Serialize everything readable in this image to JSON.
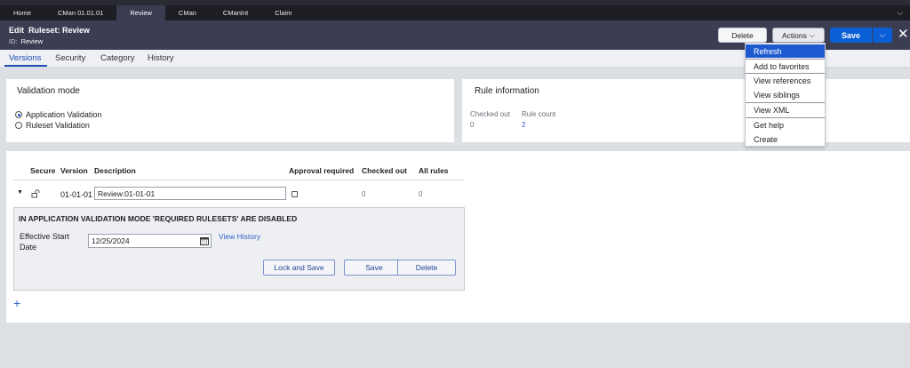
{
  "tabs": [
    {
      "label": "Home",
      "active": false
    },
    {
      "label": "CMan 01.01.01",
      "active": false
    },
    {
      "label": "Review",
      "active": true
    },
    {
      "label": "CMan",
      "active": false
    },
    {
      "label": "CManInt",
      "active": false
    },
    {
      "label": "Claim",
      "active": false
    }
  ],
  "header": {
    "edit_label": "Edit",
    "title": "Ruleset: Review",
    "id_label": "ID:",
    "id_value": "Review"
  },
  "toolbar": {
    "delete_label": "Delete",
    "actions_label": "Actions",
    "save_label": "Save"
  },
  "actions_menu": [
    {
      "label": "Refresh",
      "highlighted": true
    },
    {
      "label": "Add to favorites"
    },
    {
      "label": "View references"
    },
    {
      "label": "View siblings"
    },
    {
      "label": "View XML"
    },
    {
      "label": "Get help"
    },
    {
      "label": "Create"
    }
  ],
  "subtabs": [
    "Versions",
    "Security",
    "Category",
    "History"
  ],
  "validation": {
    "title": "Validation mode",
    "options": [
      "Application Validation",
      "Ruleset Validation"
    ],
    "selected": "Application Validation"
  },
  "rule_info": {
    "title": "Rule information",
    "checked_out_label": "Checked out",
    "checked_out_value": "0",
    "rule_count_label": "Rule count",
    "rule_count_value": "2"
  },
  "versions_table": {
    "headers": [
      "Secure",
      "Version",
      "Description",
      "Approval required",
      "Checked out",
      "All rules"
    ],
    "row": {
      "version": "01-01-01",
      "description": "Review:01-01-01",
      "checked_out": "0",
      "all_rules": "0"
    }
  },
  "detail": {
    "notice": "IN APPLICATION VALIDATION MODE 'REQUIRED RULESETS' ARE DISABLED",
    "effective_start_label": "Effective Start",
    "effective_start_label_2": "Date",
    "effective_start_value": "12/25/2024",
    "view_history": "View History",
    "lock_and_save": "Lock and Save",
    "save": "Save",
    "delete": "Delete"
  },
  "add_icon_glyph": "+",
  "icons": [
    "caret-down-icon",
    "lock-open-icon",
    "calendar-icon",
    "close-icon",
    "plus-icon",
    "chevron-down-icon"
  ],
  "colors": {
    "accent": "#0a5fd6",
    "header_bg": "#3b3d52",
    "link": "#2e5ec8"
  }
}
